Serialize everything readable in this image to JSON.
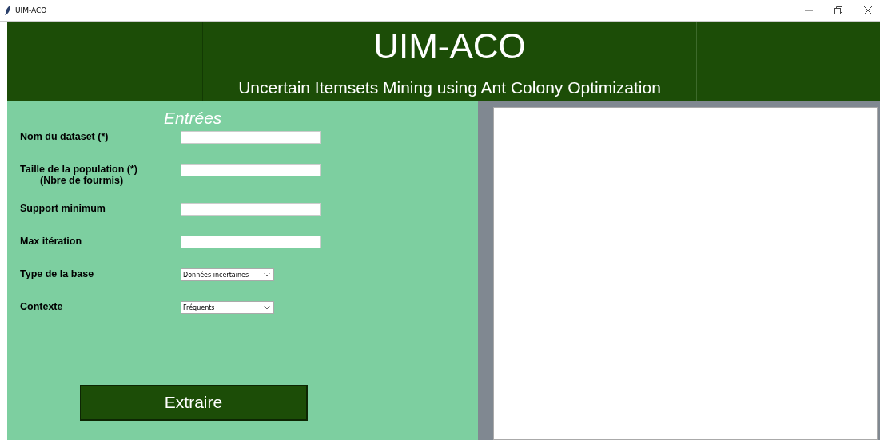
{
  "window": {
    "title": "UIM-ACO"
  },
  "header": {
    "title": "UIM-ACO",
    "subtitle": "Uncertain Itemsets Mining using Ant Colony Optimization"
  },
  "inputs": {
    "heading": "Entrées",
    "fields": [
      {
        "kind": "text",
        "label": "Nom du dataset (*)"
      },
      {
        "kind": "text",
        "label": "Taille de la population (*)",
        "sublabel": "(Nbre de fourmis)"
      },
      {
        "kind": "text",
        "label": "Support minimum"
      },
      {
        "kind": "text",
        "label": "Max itération"
      },
      {
        "kind": "select",
        "label": "Type de la base",
        "value": "Données incertaines"
      },
      {
        "kind": "select",
        "label": "Contexte",
        "value": "Fréquents"
      }
    ],
    "button": "Extraire"
  }
}
